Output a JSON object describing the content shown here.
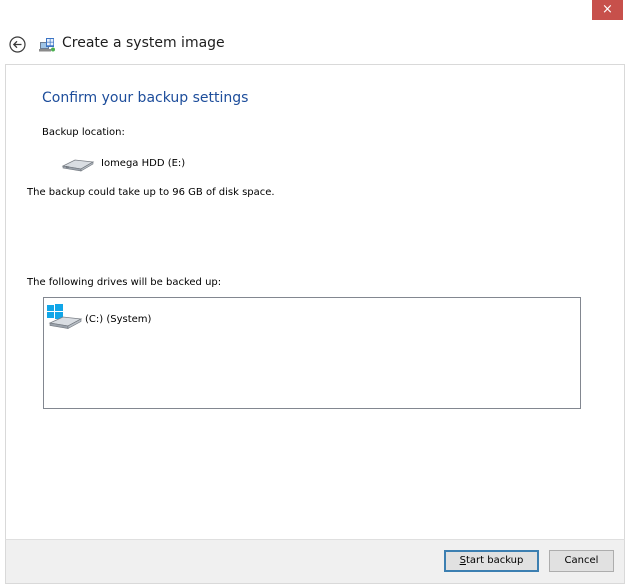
{
  "window": {
    "title": "Create a system image",
    "close_label": "×"
  },
  "content": {
    "heading": "Confirm your backup settings",
    "backup_location_label": "Backup location:",
    "backup_drive_name": "Iomega HDD (E:)",
    "space_note": "The backup could take up to 96 GB of disk space.",
    "drives_label": "The following drives will be backed up:",
    "drives": [
      {
        "label": "(C:) (System)"
      }
    ]
  },
  "footer": {
    "start_backup_mnemonic": "S",
    "start_backup_rest": "tart backup",
    "cancel_label": "Cancel"
  },
  "colors": {
    "heading": "#1d4d9b",
    "close_button": "#c7504b",
    "footer_bg": "#f0f0f0",
    "windows_logo": "#0ea5e9"
  }
}
